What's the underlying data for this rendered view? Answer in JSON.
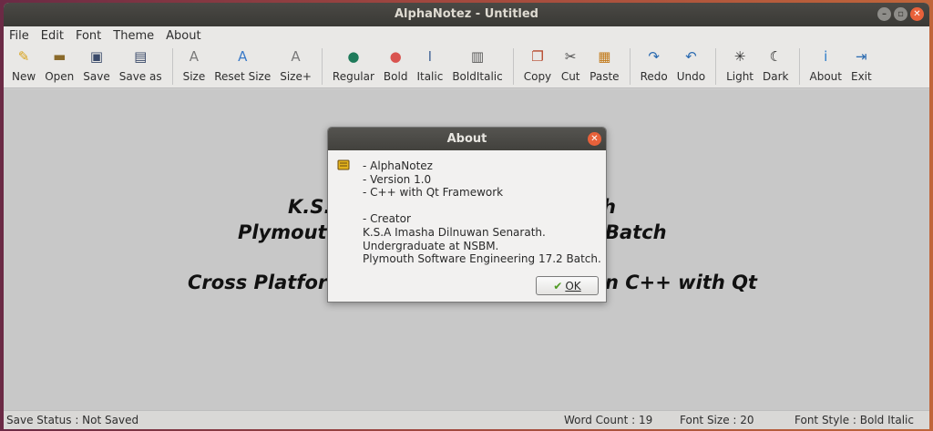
{
  "window": {
    "title": "AlphaNotez - Untitled"
  },
  "menu": [
    "File",
    "Edit",
    "Font",
    "Theme",
    "About"
  ],
  "toolbar": {
    "groups": [
      [
        {
          "name": "new",
          "label": "New",
          "icon": "new-file-icon",
          "glyph": "✎",
          "color": "#d8a21a"
        },
        {
          "name": "open",
          "label": "Open",
          "icon": "open-folder-icon",
          "glyph": "▬",
          "color": "#8a6a2a"
        },
        {
          "name": "save",
          "label": "Save",
          "icon": "save-disk-icon",
          "glyph": "▣",
          "color": "#3a4a6a"
        },
        {
          "name": "save-as",
          "label": "Save as",
          "icon": "save-as-icon",
          "glyph": "▤",
          "color": "#3a4a6a"
        }
      ],
      [
        {
          "name": "size",
          "label": "Size",
          "icon": "font-size-icon",
          "glyph": "A",
          "color": "#7a7a7a"
        },
        {
          "name": "reset-size",
          "label": "Reset Size",
          "icon": "reset-size-icon",
          "glyph": "A",
          "color": "#3a7ac8"
        },
        {
          "name": "size-plus",
          "label": "Size+",
          "icon": "size-increase-icon",
          "glyph": "A",
          "color": "#7a7a7a"
        }
      ],
      [
        {
          "name": "regular",
          "label": "Regular",
          "icon": "regular-font-icon",
          "glyph": "●",
          "color": "#1e7a5a"
        },
        {
          "name": "bold",
          "label": "Bold",
          "icon": "bold-font-icon",
          "glyph": "●",
          "color": "#d9534f"
        },
        {
          "name": "italic",
          "label": "Italic",
          "icon": "italic-font-icon",
          "glyph": "I",
          "color": "#4a6a9a"
        },
        {
          "name": "bolditalic",
          "label": "BoldItalic",
          "icon": "bold-italic-icon",
          "glyph": "▥",
          "color": "#5a5a5a"
        }
      ],
      [
        {
          "name": "copy",
          "label": "Copy",
          "icon": "copy-icon",
          "glyph": "❐",
          "color": "#b5462a"
        },
        {
          "name": "cut",
          "label": "Cut",
          "icon": "scissors-icon",
          "glyph": "✂",
          "color": "#4a4a4a"
        },
        {
          "name": "paste",
          "label": "Paste",
          "icon": "paste-icon",
          "glyph": "▦",
          "color": "#c27a1a"
        }
      ],
      [
        {
          "name": "redo",
          "label": "Redo",
          "icon": "redo-arrow-icon",
          "glyph": "↷",
          "color": "#2a6ab0"
        },
        {
          "name": "undo",
          "label": "Undo",
          "icon": "undo-arrow-icon",
          "glyph": "↶",
          "color": "#2a6ab0"
        }
      ],
      [
        {
          "name": "light",
          "label": "Light",
          "icon": "sun-icon",
          "glyph": "✳",
          "color": "#333333"
        },
        {
          "name": "dark",
          "label": "Dark",
          "icon": "moon-icon",
          "glyph": "☾",
          "color": "#111111"
        }
      ],
      [
        {
          "name": "about",
          "label": "About",
          "icon": "info-icon",
          "glyph": "i",
          "color": "#2a7ac8"
        },
        {
          "name": "exit",
          "label": "Exit",
          "icon": "exit-door-icon",
          "glyph": "⇥",
          "color": "#2a6ab0"
        }
      ]
    ]
  },
  "document": {
    "line1": "K.S.",
    "line1_end": "h",
    "line2": "Plymouth",
    "line2_end": "Batch",
    "line3": "Cross Platform",
    "line3_end": "n C++ with Qt"
  },
  "about_dialog": {
    "title": "About",
    "icon": "app-notebook-icon",
    "lines": [
      "- AlphaNotez",
      "- Version 1.0",
      "- C++ with Qt Framework",
      "",
      "- Creator",
      "  K.S.A Imasha Dilnuwan Senarath.",
      "  Undergraduate at NSBM.",
      "  Plymouth Software Engineering 17.2 Batch."
    ],
    "ok_label": "OK"
  },
  "status": {
    "save_status": "Save Status : Not Saved",
    "word_count": "Word Count : 19",
    "font_size": "Font Size : 20",
    "font_style": "Font Style : Bold Italic"
  }
}
